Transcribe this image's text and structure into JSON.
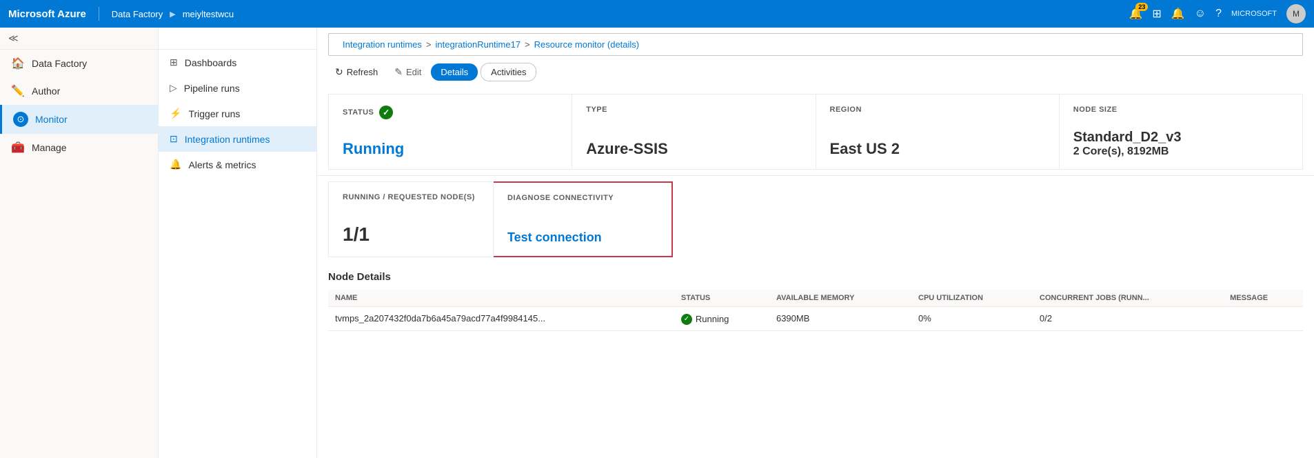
{
  "topbar": {
    "brand": "Microsoft Azure",
    "divider": "|",
    "nav1": "Data Factory",
    "nav_arrow": "▶",
    "nav2": "meiyltestwcu",
    "notification_count": "23",
    "user_label": "MICROSOFT"
  },
  "left_nav": {
    "collapse_icon": "≡",
    "items": [
      {
        "id": "data-factory",
        "label": "Data Factory",
        "icon": "🏠"
      },
      {
        "id": "author",
        "label": "Author",
        "icon": "✏️"
      },
      {
        "id": "monitor",
        "label": "Monitor",
        "icon": "🔵",
        "active": true
      },
      {
        "id": "manage",
        "label": "Manage",
        "icon": "🧰"
      }
    ]
  },
  "subnav": {
    "items": [
      {
        "id": "dashboards",
        "label": "Dashboards",
        "icon": "⊞"
      },
      {
        "id": "pipeline-runs",
        "label": "Pipeline runs",
        "icon": "▶"
      },
      {
        "id": "trigger-runs",
        "label": "Trigger runs",
        "icon": "⚡"
      },
      {
        "id": "integration-runtimes",
        "label": "Integration runtimes",
        "icon": "⊡",
        "active": true
      },
      {
        "id": "alerts-metrics",
        "label": "Alerts & metrics",
        "icon": "🔔"
      }
    ]
  },
  "breadcrumb": {
    "link1": "Integration runtimes",
    "sep1": ">",
    "link2": "integrationRuntime17",
    "sep2": ">",
    "current": "Resource monitor (details)"
  },
  "toolbar": {
    "refresh_label": "Refresh",
    "edit_label": "Edit",
    "tab_details": "Details",
    "tab_activities": "Activities"
  },
  "cards": [
    {
      "id": "status",
      "label": "STATUS",
      "value": "Running",
      "has_check": true,
      "value_color": "blue"
    },
    {
      "id": "type",
      "label": "TYPE",
      "value": "Azure-SSIS",
      "value_color": "dark"
    },
    {
      "id": "region",
      "label": "REGION",
      "value": "East US 2",
      "value_color": "dark"
    },
    {
      "id": "node-size",
      "label": "NODE SIZE",
      "value": "Standard_D2_v3",
      "subvalue": "2 Core(s), 8192MB",
      "value_color": "dark"
    }
  ],
  "cards2": [
    {
      "id": "running-nodes",
      "label": "RUNNING / REQUESTED NODE(S)",
      "value": "1/1"
    },
    {
      "id": "diagnose",
      "label": "DIAGNOSE CONNECTIVITY",
      "value": "Test connection",
      "is_link": true
    }
  ],
  "node_details": {
    "title": "Node Details",
    "columns": [
      "NAME",
      "STATUS",
      "AVAILABLE MEMORY",
      "CPU UTILIZATION",
      "CONCURRENT JOBS (RUNN...",
      "MESSAGE"
    ],
    "rows": [
      {
        "name": "tvmps_2a207432f0da7b6a45a79acd77a4f9984145...",
        "status": "Running",
        "available_memory": "6390MB",
        "cpu_utilization": "0%",
        "concurrent_jobs": "0/2",
        "message": ""
      }
    ]
  },
  "icons": {
    "refresh": "↻",
    "edit": "✎",
    "check": "✓",
    "arrow_right": "▶",
    "bell": "🔔",
    "smiley": "☺",
    "question": "?",
    "grid": "⊞",
    "lightning": "⚡",
    "monitor": "⊙",
    "alert": "🔔"
  }
}
